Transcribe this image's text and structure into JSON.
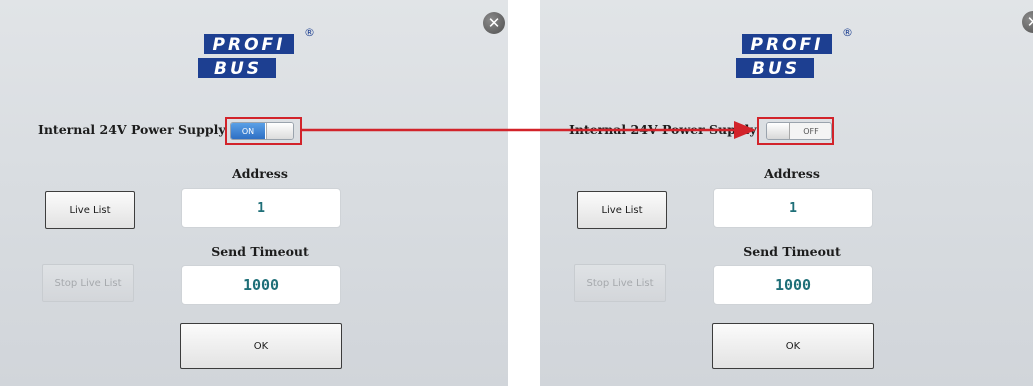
{
  "logo": {
    "line1": "PROFI",
    "line2": "BUS",
    "registered": "®"
  },
  "icons": {
    "close": "close-icon"
  },
  "panels": [
    {
      "close_glyph": "✕",
      "power_supply_label": "Internal 24V Power Supply",
      "toggle_state": "ON",
      "address_label": "Address",
      "address_value": "1",
      "timeout_label": "Send Timeout",
      "timeout_value": "1000",
      "live_list_button": "Live List",
      "stop_live_list_button": "Stop Live List",
      "ok_button": "OK"
    },
    {
      "close_glyph": "✕",
      "power_supply_label": "Internal 24V Power Supply",
      "toggle_state": "OFF",
      "address_label": "Address",
      "address_value": "1",
      "timeout_label": "Send Timeout",
      "timeout_value": "1000",
      "live_list_button": "Live List",
      "stop_live_list_button": "Stop Live List",
      "ok_button": "OK"
    }
  ],
  "colors": {
    "highlight": "#d2232a",
    "toggle_on": "#2e6fc4",
    "logo": "#1d3f91",
    "value_text": "#1f6f78"
  }
}
